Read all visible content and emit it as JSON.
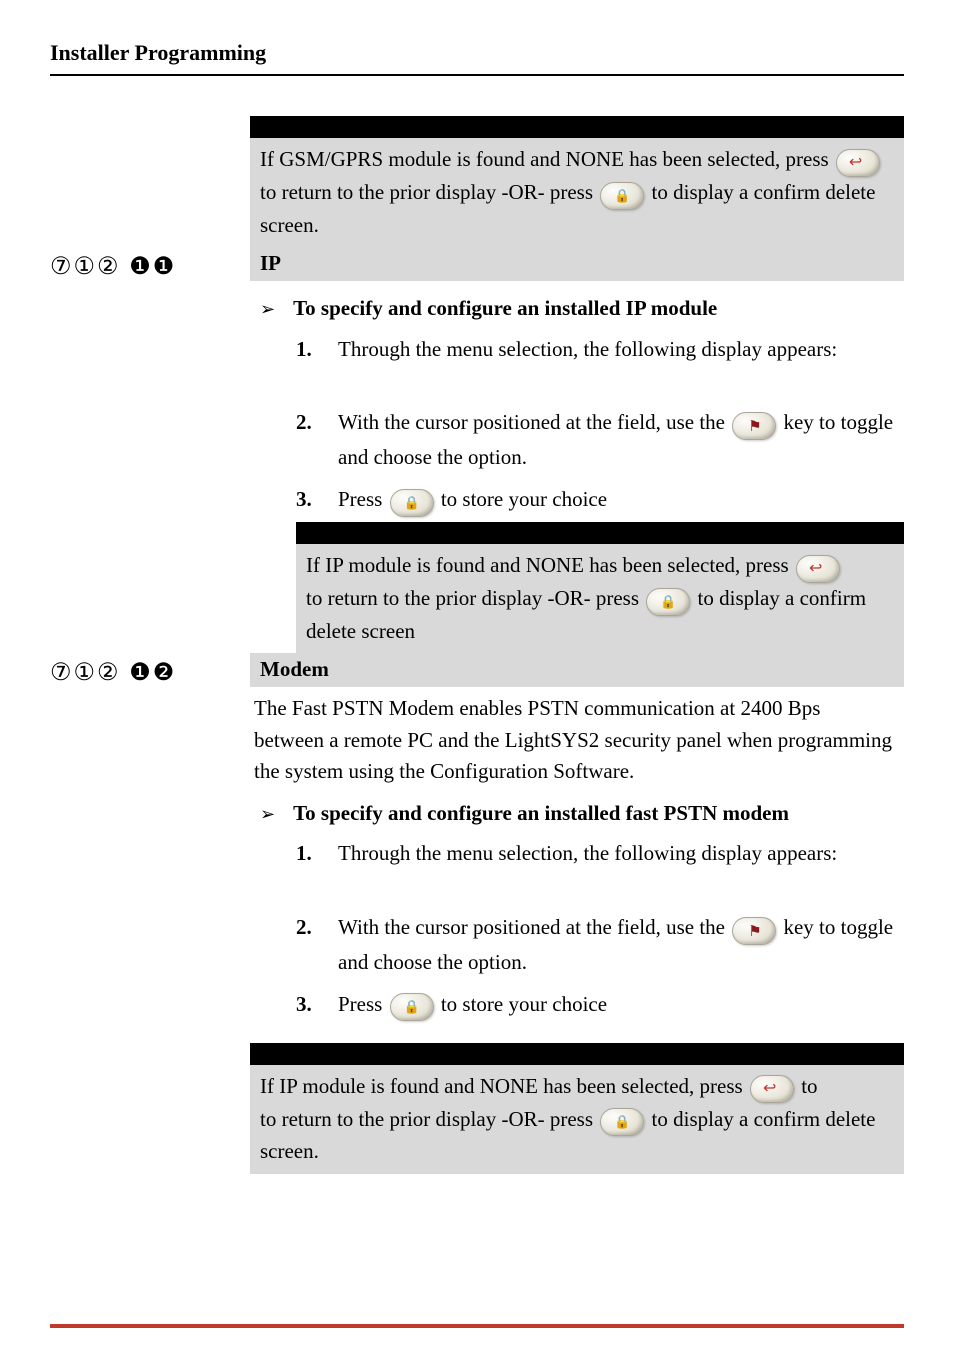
{
  "header": "Installer Programming",
  "note1": {
    "text_a": "If GSM/GPRS module is found and NONE has been selected, press ",
    "text_b": "to return to the prior display -OR- press ",
    "text_c": "to display a confirm delete screen."
  },
  "section_ip": {
    "code": "⑦①② ❶❶",
    "title": "IP",
    "bullet_title": "To specify and configure an installed IP module",
    "step1": "Through the menu selection, the following display appears:",
    "step2_a": "With the cursor positioned at the ",
    "step2_b": " field, use the ",
    "step2_c": "key to toggle and choose the ",
    "step2_d": " option.",
    "step3_a": "Press ",
    "step3_b": "to store your choice",
    "note_a": "If IP module is found and NONE has been selected, press ",
    "note_b": "to return to the prior display -OR- press ",
    "note_c": "to display a confirm delete screen"
  },
  "section_modem": {
    "code": "⑦①② ❶❷",
    "title": "Modem",
    "intro": "The Fast PSTN Modem enables PSTN communication at 2400 Bps between a remote PC and the LightSYS2 security panel when programming the system using the Configuration Software.",
    "bullet_title": "To specify and configure an installed fast PSTN modem",
    "step1": "Through the menu selection, the following display appears:",
    "step2_a": "With the cursor positioned at the ",
    "step2_b": " field, use the ",
    "step2_c": "key to toggle and choose the ",
    "step2_d": " option.",
    "step3_a": "Press ",
    "step3_b": "to store your choice",
    "note_a": "If IP module is found and NONE has been selected, press ",
    "note_b": "to return to the prior display -OR- press ",
    "note_c": "to display a confirm delete screen."
  }
}
